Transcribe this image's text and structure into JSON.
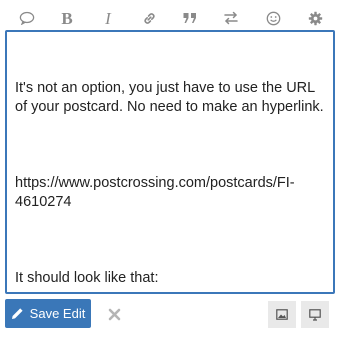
{
  "toolbar": {
    "bold_label": "B",
    "italic_label": "I",
    "icons": [
      "speech-bubble-icon",
      "bold-icon",
      "italic-icon",
      "link-icon",
      "quote-icon",
      "swap-arrows-icon",
      "smiley-icon",
      "gear-icon"
    ]
  },
  "editor": {
    "paragraph_1": "It's not an option, you just have to use the URL of your postcard. No need to make an hyperlink.",
    "paragraph_2": "https://www.postcrossing.com/postcards/FI-4610274",
    "paragraph_3": "It should look like that:"
  },
  "footer": {
    "save_label": "Save Edit"
  },
  "colors": {
    "accent": "#3a77b8",
    "icon_gray": "#8a8a8a"
  }
}
